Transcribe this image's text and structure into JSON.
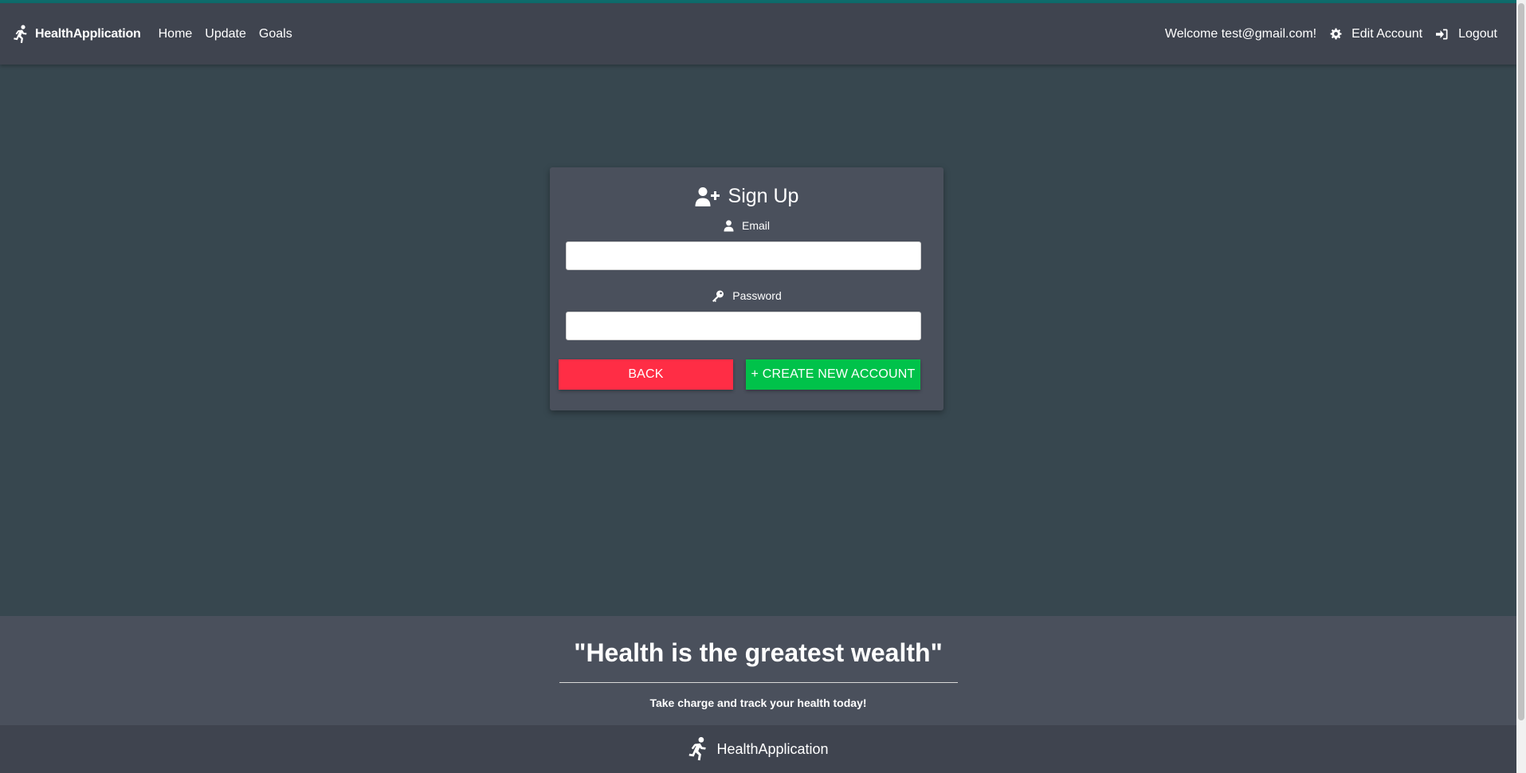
{
  "navbar": {
    "brand": "HealthApplication",
    "links": [
      "Home",
      "Update",
      "Goals"
    ],
    "welcome": "Welcome test@gmail.com!",
    "edit_account": "Edit Account",
    "logout": "Logout"
  },
  "signup": {
    "title": "Sign Up",
    "email_label": "Email",
    "email_value": "",
    "password_label": "Password",
    "password_value": "",
    "back_label": "BACK",
    "create_label": "+ CREATE NEW ACCOUNT"
  },
  "quote_section": {
    "quote": "\"Health is the greatest wealth\"",
    "tagline": "Take charge and track your health today!"
  },
  "footer": {
    "brand": "HealthApplication"
  },
  "colors": {
    "background": "#37474f",
    "navbar": "#3f444f",
    "card": "#4a505c",
    "back_button": "#ff2d45",
    "create_button": "#00c24a"
  },
  "icons": {
    "brand": "running-person-icon",
    "settings": "gear-icon",
    "logout": "sign-in-arrow-icon",
    "signup": "user-plus-icon",
    "email": "user-icon",
    "password": "key-icon"
  }
}
